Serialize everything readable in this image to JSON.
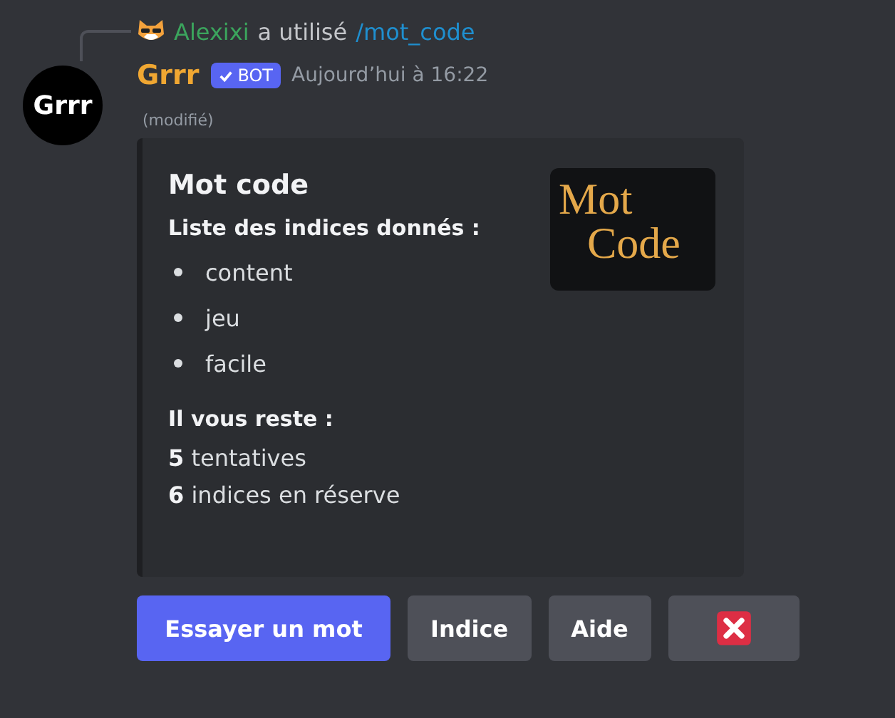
{
  "reply": {
    "user": "Alexixi",
    "action": "a utilisé",
    "command": "/mot_code"
  },
  "message": {
    "avatar_text": "Grrr",
    "author": "Grrr",
    "badge": "BOT",
    "timestamp": "Aujourd’hui à 16:22",
    "edited": "(modifié)"
  },
  "embed": {
    "title": "Mot code",
    "thumbnail": [
      "Mot",
      "Code"
    ],
    "fields": [
      {
        "kind": "list",
        "name": "Liste des indices donnés :",
        "items": [
          "content",
          "jeu",
          "facile"
        ]
      },
      {
        "kind": "lines",
        "name": "Il vous reste :",
        "lines": [
          "**5** tentatives",
          "**6** indices en réserve"
        ]
      }
    ]
  },
  "buttons": [
    {
      "kind": "primary",
      "label": "Essayer un mot"
    },
    {
      "kind": "secondary",
      "label": "Indice"
    },
    {
      "kind": "secondary",
      "label": "Aide"
    },
    {
      "kind": "cross"
    }
  ]
}
